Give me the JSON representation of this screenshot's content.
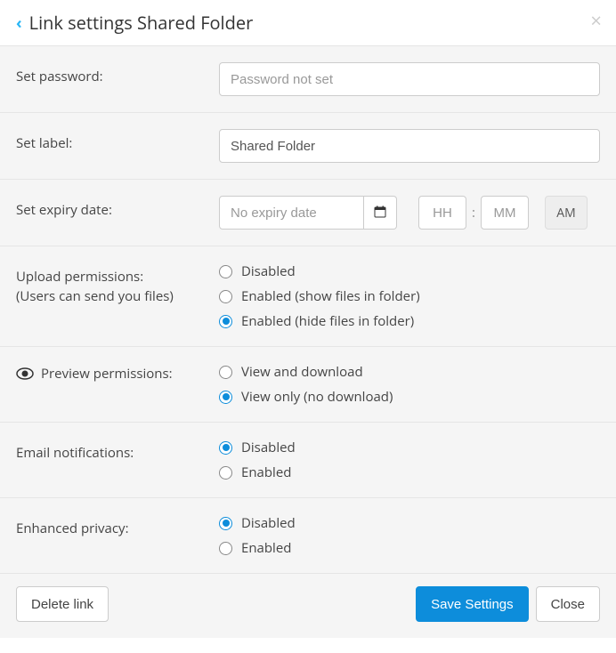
{
  "header": {
    "title": "Link settings Shared Folder"
  },
  "password": {
    "label": "Set password:",
    "placeholder": "Password not set",
    "value": ""
  },
  "label": {
    "label": "Set label:",
    "value": "Shared Folder"
  },
  "expiry": {
    "label": "Set expiry date:",
    "date_placeholder": "No expiry date",
    "date_value": "",
    "hh_placeholder": "HH",
    "hh_value": "",
    "mm_placeholder": "MM",
    "mm_value": "",
    "ampm": "AM"
  },
  "upload": {
    "label": "Upload permissions:",
    "sub": "(Users can send you files)",
    "options": [
      {
        "label": "Disabled",
        "checked": false
      },
      {
        "label": "Enabled (show files in folder)",
        "checked": false
      },
      {
        "label": "Enabled (hide files in folder)",
        "checked": true
      }
    ]
  },
  "preview": {
    "label": "Preview permissions:",
    "options": [
      {
        "label": "View and download",
        "checked": false
      },
      {
        "label": "View only (no download)",
        "checked": true
      }
    ]
  },
  "email": {
    "label": "Email notifications:",
    "options": [
      {
        "label": "Disabled",
        "checked": true
      },
      {
        "label": "Enabled",
        "checked": false
      }
    ]
  },
  "privacy": {
    "label": "Enhanced privacy:",
    "options": [
      {
        "label": "Disabled",
        "checked": true
      },
      {
        "label": "Enabled",
        "checked": false
      }
    ]
  },
  "footer": {
    "delete": "Delete link",
    "save": "Save Settings",
    "close": "Close"
  }
}
